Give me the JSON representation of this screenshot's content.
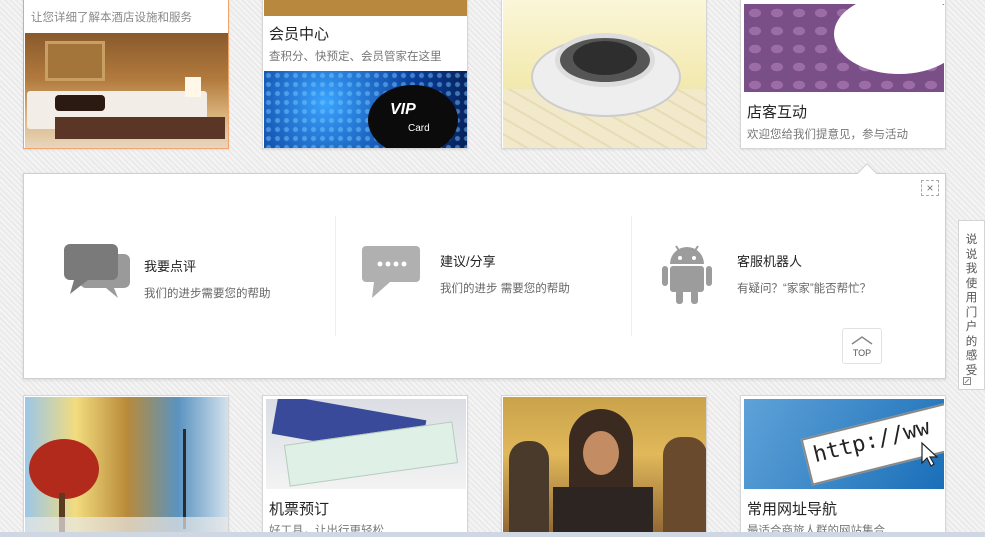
{
  "cards_top": [
    {
      "name": "hotel-facilities",
      "caption": "",
      "sub": "让您详细了解本酒店设施和服务"
    },
    {
      "name": "member-center",
      "caption": "会员中心",
      "sub": "查积分、快预定、会员管家在这里",
      "badge": "VIP",
      "badge_sub": "Card"
    },
    {
      "name": "hotel-map",
      "caption": "",
      "sub": ""
    },
    {
      "name": "guest-interaction",
      "caption": "店客互动",
      "sub": "欢迎您给我们提意见，参与活动"
    }
  ],
  "panel": {
    "close_label": "×",
    "options": [
      {
        "title": "我要点评",
        "desc": "我们的进步需要您的帮助",
        "icon": "chat-bubbles-icon"
      },
      {
        "title": "建议/分享",
        "desc": "我们的进步 需要您的帮助",
        "icon": "speech-bubble-icon"
      },
      {
        "title": "客服机器人",
        "desc": "有疑问？“家家”能否帮忙？",
        "icon": "android-robot-icon"
      }
    ],
    "top_label": "TOP"
  },
  "side_tab": {
    "chars": [
      "说",
      "说",
      "我",
      "使",
      "用",
      "门",
      "户",
      "的",
      "感",
      "受"
    ]
  },
  "cards_bottom": [
    {
      "name": "weather",
      "caption": "",
      "sub": ""
    },
    {
      "name": "flight-booking",
      "caption": "机票预订",
      "sub": "好工具，让出行更轻松"
    },
    {
      "name": "movies",
      "caption": "",
      "sub": ""
    },
    {
      "name": "url-navigation",
      "caption": "常用网址导航",
      "sub": "最适合商旅人群的网站集合",
      "url_text": "http://ww"
    }
  ]
}
